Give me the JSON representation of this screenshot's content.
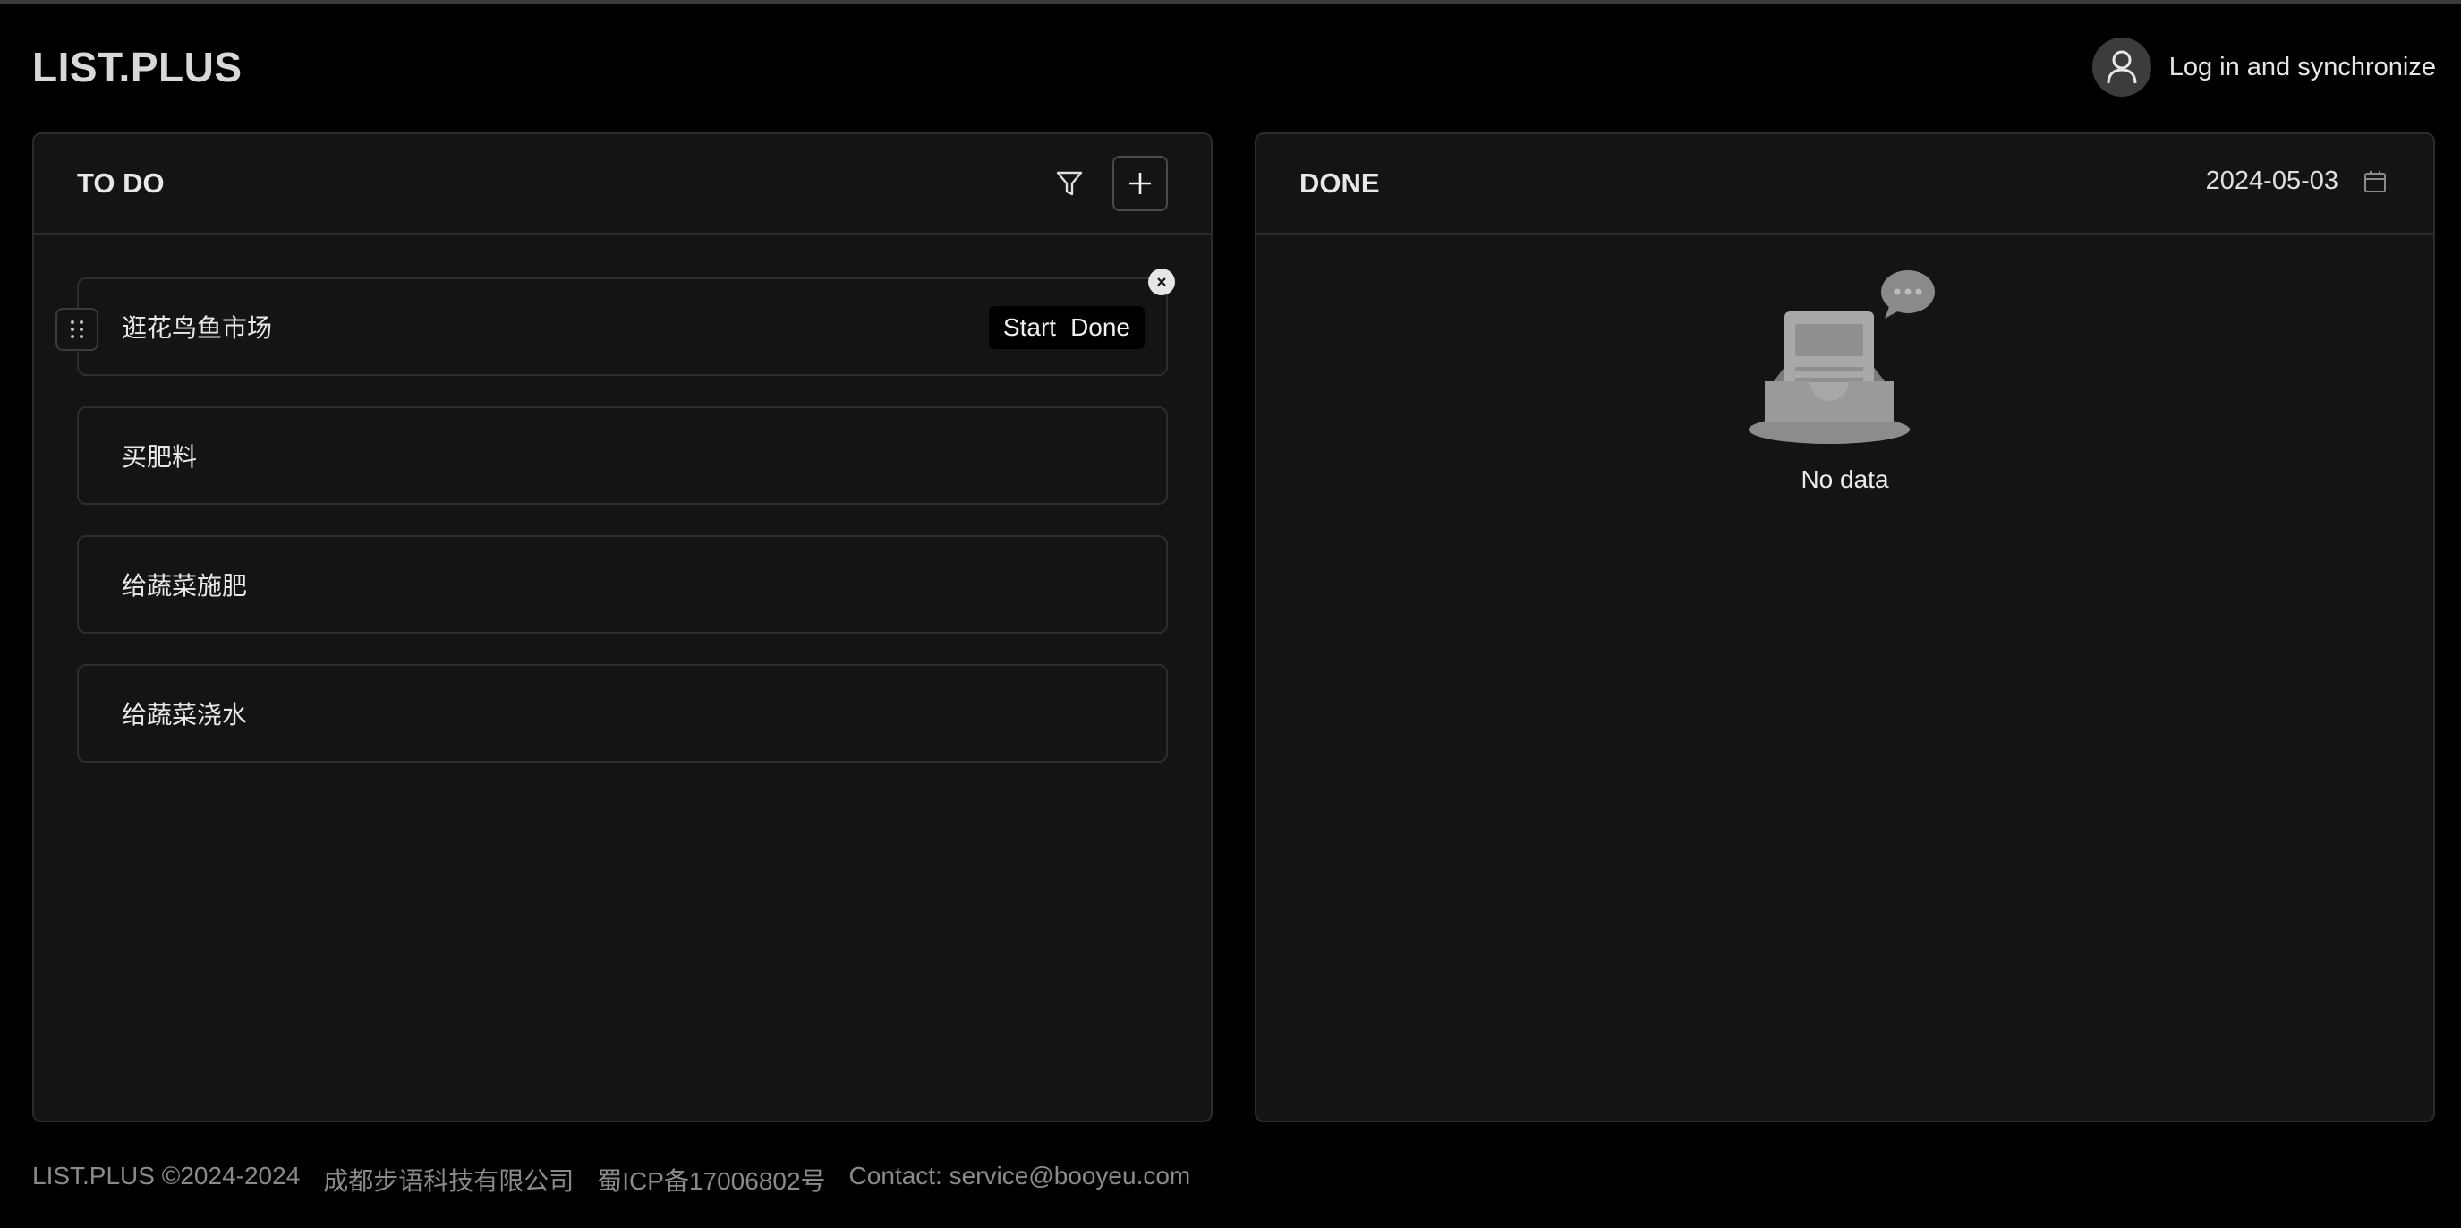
{
  "app": {
    "logo": "LIST.PLUS"
  },
  "header": {
    "login_label": "Log in and synchronize",
    "avatar_icon": "user-icon"
  },
  "todo": {
    "title": "TO DO",
    "filter_icon": "filter-icon",
    "add_icon": "plus-icon",
    "tasks": [
      {
        "text": "逛花鸟鱼市场",
        "actions": [
          "Start",
          "Done"
        ]
      },
      {
        "text": "买肥料"
      },
      {
        "text": "给蔬菜施肥"
      },
      {
        "text": "给蔬菜浇水"
      }
    ]
  },
  "done": {
    "title": "DONE",
    "date": "2024-05-03",
    "calendar_icon": "calendar-icon",
    "empty_text": "No data"
  },
  "footer": {
    "copyright": "LIST.PLUS ©2024-2024",
    "company": "成都步语科技有限公司",
    "icp": "蜀ICP备17006802号",
    "contact": "Contact: service@booyeu.com"
  },
  "colors": {
    "background": "#000000",
    "panel": "#141414",
    "border": "#2b2b2b",
    "muted_text": "#8a8a8a"
  }
}
